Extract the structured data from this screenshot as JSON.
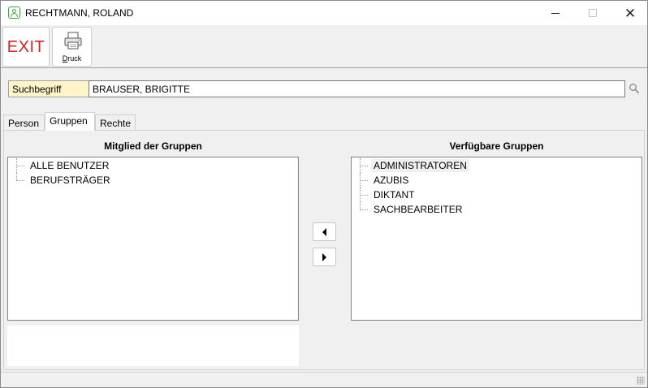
{
  "window": {
    "title": "RECHTMANN, ROLAND",
    "icon": "user-card-icon",
    "controls": {
      "minimize": "minimize-icon",
      "maximize": "maximize-icon",
      "close": "close-icon"
    }
  },
  "toolbar": {
    "exit_label": "EXIT",
    "druck_label_accel": "D",
    "druck_label_rest": "ruck",
    "druck_icon": "printer-icon"
  },
  "search": {
    "label": "Suchbegriff",
    "value": "BRAUSER, BRIGITTE",
    "button_icon": "magnifier-icon"
  },
  "tabs": [
    {
      "label": "Person",
      "active": false
    },
    {
      "label": "Gruppen",
      "active": true
    },
    {
      "label": "Rechte",
      "active": false
    }
  ],
  "member_groups": {
    "title": "Mitglied der Gruppen",
    "items": [
      "ALLE BENUTZER",
      "BERUFSTRÄGER"
    ]
  },
  "available_groups": {
    "title": "Verfügbare Gruppen",
    "items": [
      "ADMINISTRATOREN",
      "AZUBIS",
      "DIKTANT",
      "SACHBEARBEITER"
    ],
    "selected": "ADMINISTRATOREN"
  },
  "transfer_buttons": {
    "add_icon": "arrow-left-icon",
    "remove_icon": "arrow-right-icon"
  },
  "colors": {
    "exit_red": "#d32222",
    "search_label_bg": "#fff5c8",
    "app_icon_green": "#3fa33f"
  }
}
